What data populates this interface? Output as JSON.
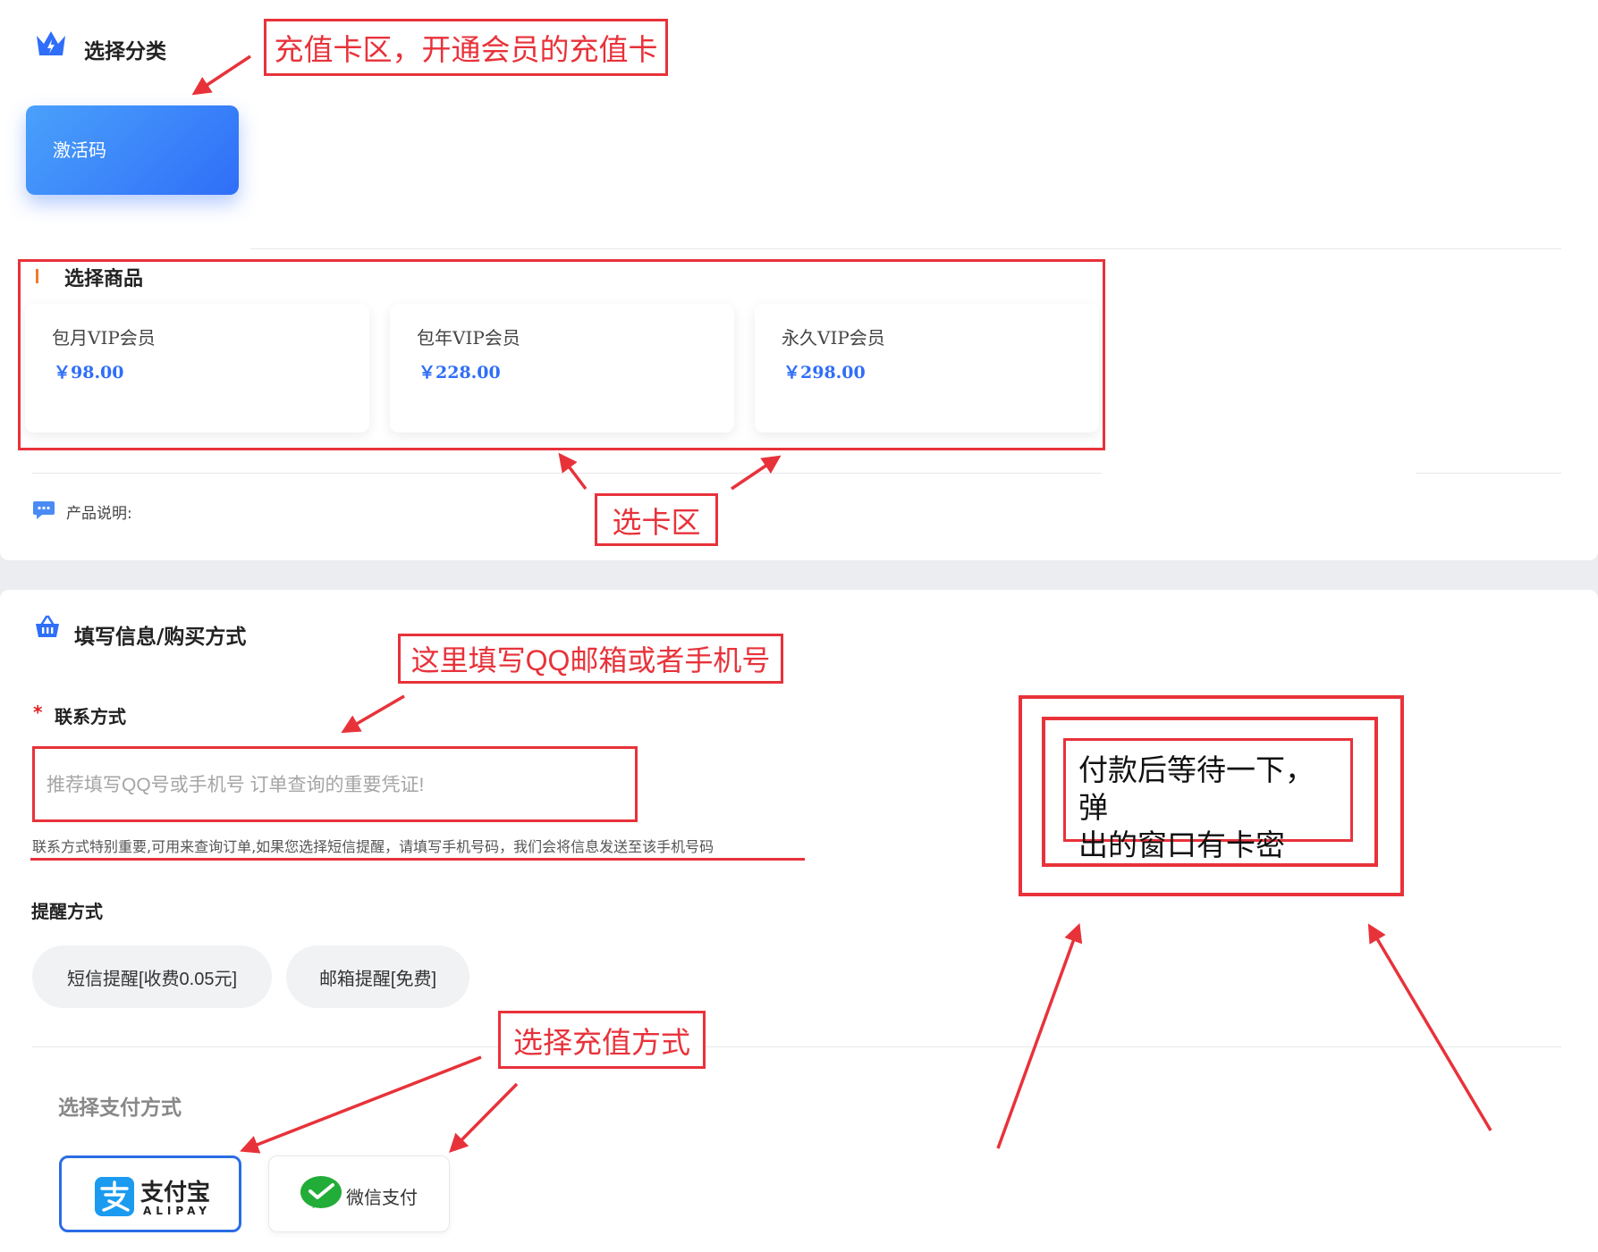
{
  "category_section": {
    "title": "选择分类",
    "selected_category": "激活码"
  },
  "goods_section": {
    "title": "选择商品",
    "products": [
      {
        "name": "包月VIP会员",
        "price": "￥98.00"
      },
      {
        "name": "包年VIP会员",
        "price": "￥228.00"
      },
      {
        "name": "永久VIP会员",
        "price": "￥298.00"
      }
    ],
    "description_label": "产品说明:"
  },
  "order_section": {
    "title": "填写信息/购买方式",
    "contact_label": "联系方式",
    "contact_required_mark": "*",
    "contact_placeholder": "推荐填写QQ号或手机号 订单查询的重要凭证!",
    "contact_hint": "联系方式特别重要,可用来查询订单,如果您选择短信提醒，请填写手机号码，我们会将信息发送至该手机号码",
    "remind_label": "提醒方式",
    "remind_options": [
      "短信提醒[收费0.05元]",
      "邮箱提醒[免费]"
    ],
    "payment_label": "选择支付方式",
    "payments": [
      {
        "name": "支付宝",
        "sub": "ALIPAY"
      },
      {
        "name": "微信支付"
      }
    ]
  },
  "annotations": {
    "recharge_area": "充值卡区，开通会员的充值卡",
    "card_area": "选卡区",
    "fill_contact": "这里填写QQ邮箱或者手机号",
    "choose_payment": "选择充值方式",
    "after_payment_line1": "付款后等待一下，弹",
    "after_payment_line2": "出的窗口有卡密"
  },
  "colors": {
    "accent_blue": "#2f6ef8",
    "annotation_red": "#e8323a",
    "required_red": "#e02020",
    "goods_bar_orange": "#f07b2d"
  }
}
